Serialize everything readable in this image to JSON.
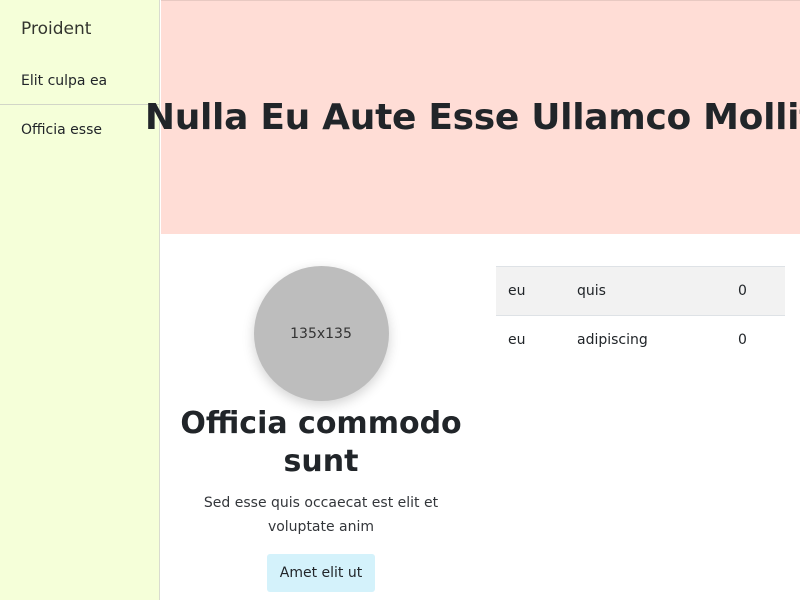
{
  "sidebar": {
    "brand": "Proident",
    "items": [
      {
        "label": "Elit culpa ea"
      },
      {
        "label": "Officia esse"
      }
    ]
  },
  "hero": {
    "title": "Nulla Eu Aute Esse Ullamco Mollit"
  },
  "card": {
    "avatar_text": "135x135",
    "title": "Officia commodo sunt",
    "text": "Sed esse quis occaecat est elit et voluptate anim",
    "button": "Amet elit ut"
  },
  "table": {
    "rows": [
      [
        "eu",
        "quis",
        "0"
      ],
      [
        "eu",
        "adipiscing",
        "0"
      ]
    ]
  },
  "colors": {
    "sidebar_bg": "#f5ffd9",
    "hero_bg": "#ffddd6",
    "button_bg": "#d4f2fb",
    "avatar_bg": "#bdbdbd"
  }
}
